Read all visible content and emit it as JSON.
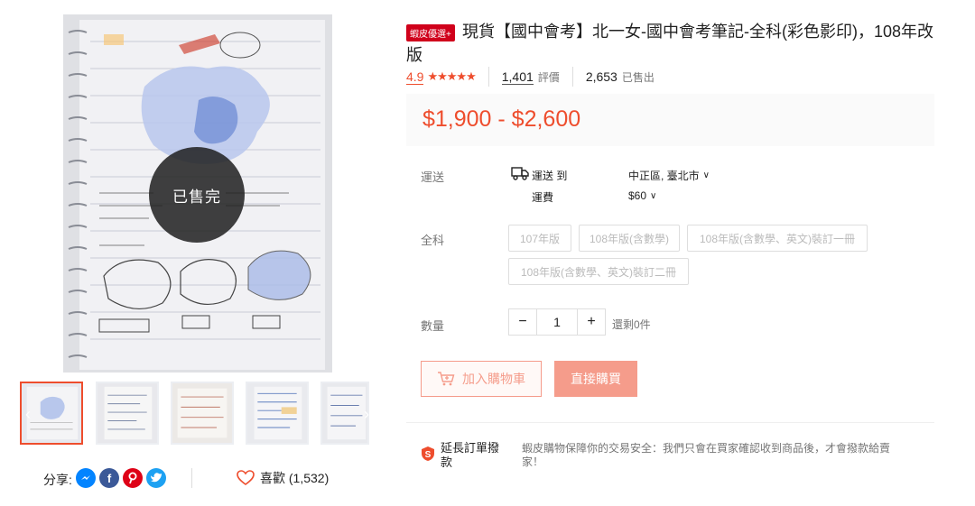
{
  "gallery": {
    "sold_out_label": "已售完",
    "thumbnail_count": 5,
    "active_thumbnail": 1
  },
  "share": {
    "label": "分享:",
    "networks": [
      "messenger-icon",
      "facebook-icon",
      "pinterest-icon",
      "twitter-icon"
    ],
    "fb_letter": "f"
  },
  "like": {
    "label": "喜歡 (1,532)",
    "icon": "heart-outline-icon"
  },
  "product": {
    "badge": "蝦皮優選+",
    "title": "現貨【國中會考】北一女-國中會考筆記-全科(彩色影印)，108年改版",
    "rating_value": "4.9",
    "stars": 5,
    "review_count": "1,401",
    "review_label": "評價",
    "sold_count": "2,653",
    "sold_label": "已售出",
    "price": "$1,900 - $2,600"
  },
  "shipping": {
    "label": "運送",
    "to_label": "運送 到",
    "destination": "中正區, 臺北市",
    "fee_label": "運費",
    "fee": "$60"
  },
  "variation": {
    "label": "全科",
    "options": [
      "107年版",
      "108年版(含數學)",
      "108年版(含數學、英文)裝訂一冊",
      "108年版(含數學、英文)裝訂二冊"
    ]
  },
  "quantity": {
    "label": "數量",
    "minus": "−",
    "value": "1",
    "plus": "+",
    "stock_text": "還剩0件"
  },
  "actions": {
    "add_to_cart": "加入購物車",
    "buy_now": "直接購買"
  },
  "guarantee": {
    "title": "延長訂單撥款",
    "text": "蝦皮購物保障你的交易安全：我們只會在買家確認收到商品後，才會撥款給賣家！"
  },
  "colors": {
    "accent": "#ee4d2d",
    "badge": "#d0011b"
  }
}
